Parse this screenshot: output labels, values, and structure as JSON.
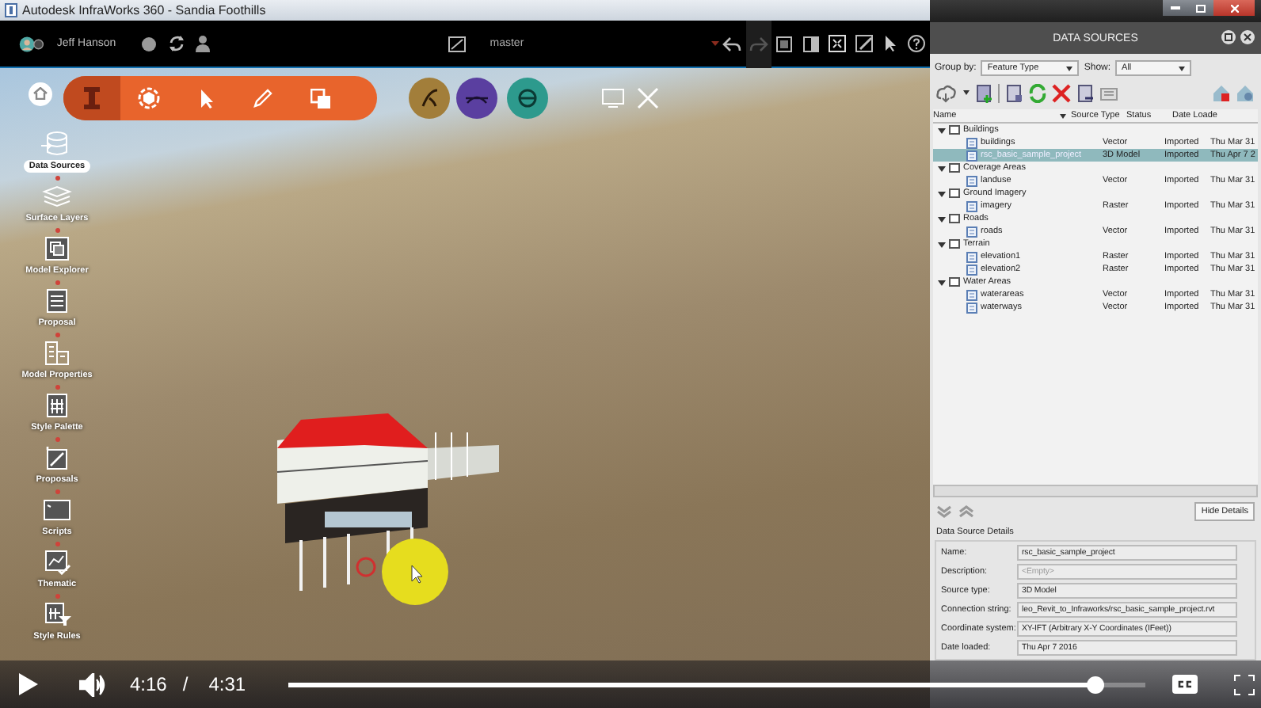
{
  "app": {
    "window_title": "Autodesk InfraWorks 360 - Sandia Foothills",
    "user_name": "Jeff Hanson",
    "branch": "master"
  },
  "sidebar": {
    "items": [
      {
        "label": "Data Sources",
        "selected": true
      },
      {
        "label": "Surface Layers",
        "selected": false
      },
      {
        "label": "Model Explorer",
        "selected": false
      },
      {
        "label": "Proposal",
        "selected": false
      },
      {
        "label": "Model Properties",
        "selected": false
      },
      {
        "label": "Style Palette",
        "selected": false
      },
      {
        "label": "Proposals",
        "selected": false
      },
      {
        "label": "Scripts",
        "selected": false
      },
      {
        "label": "Thematic",
        "selected": false
      },
      {
        "label": "Style Rules",
        "selected": false
      }
    ]
  },
  "data_sources": {
    "title": "DATA SOURCES",
    "group_by_label": "Group by:",
    "group_by": "Feature Type",
    "show_label": "Show:",
    "show": "All",
    "columns": [
      "Name",
      "Source Type",
      "Status",
      "Date Loade"
    ],
    "tree": [
      {
        "name": "Buildings",
        "expanded": true,
        "selected": false,
        "children": [
          {
            "name": "buildings",
            "source_type": "Vector",
            "status": "Imported",
            "date": "Thu Mar 31",
            "selected": false
          },
          {
            "name": "rsc_basic_sample_project",
            "source_type": "3D Model",
            "status": "Imported",
            "date": "Thu Apr 7 2",
            "selected": true
          }
        ]
      },
      {
        "name": "Coverage Areas",
        "expanded": true,
        "selected": false,
        "children": [
          {
            "name": "landuse",
            "source_type": "Vector",
            "status": "Imported",
            "date": "Thu Mar 31",
            "selected": false
          }
        ]
      },
      {
        "name": "Ground Imagery",
        "expanded": true,
        "selected": false,
        "children": [
          {
            "name": "imagery",
            "source_type": "Raster",
            "status": "Imported",
            "date": "Thu Mar 31",
            "selected": false
          }
        ]
      },
      {
        "name": "Roads",
        "expanded": true,
        "selected": false,
        "children": [
          {
            "name": "roads",
            "source_type": "Vector",
            "status": "Imported",
            "date": "Thu Mar 31",
            "selected": false
          }
        ]
      },
      {
        "name": "Terrain",
        "expanded": true,
        "selected": false,
        "children": [
          {
            "name": "elevation1",
            "source_type": "Raster",
            "status": "Imported",
            "date": "Thu Mar 31",
            "selected": false
          },
          {
            "name": "elevation2",
            "source_type": "Raster",
            "status": "Imported",
            "date": "Thu Mar 31",
            "selected": false
          }
        ]
      },
      {
        "name": "Water Areas",
        "expanded": true,
        "selected": false,
        "children": [
          {
            "name": "waterareas",
            "source_type": "Vector",
            "status": "Imported",
            "date": "Thu Mar 31",
            "selected": false
          },
          {
            "name": "waterways",
            "source_type": "Vector",
            "status": "Imported",
            "date": "Thu Mar 31",
            "selected": false
          }
        ]
      }
    ],
    "hide_details": "Hide Details",
    "details_title": "Data Source Details",
    "details": [
      {
        "label": "Name:",
        "value": "rsc_basic_sample_project"
      },
      {
        "label": "Description:",
        "placeholder": "<Empty>"
      },
      {
        "label": "Source type:",
        "value": "3D Model"
      },
      {
        "label": "Connection string:",
        "value": "leo_Revit_to_Infraworks/rsc_basic_sample_project.rvt"
      },
      {
        "label": "Coordinate system:",
        "value": "XY-IFT (Arbitrary X-Y Coordinates (IFeet))"
      },
      {
        "label": "Date loaded:",
        "value": "Thu Apr 7 2016"
      }
    ]
  },
  "video": {
    "playing": false,
    "current_time": "4:16",
    "separator": "/",
    "duration": "4:31",
    "progress": {
      "level": 0.94
    }
  }
}
